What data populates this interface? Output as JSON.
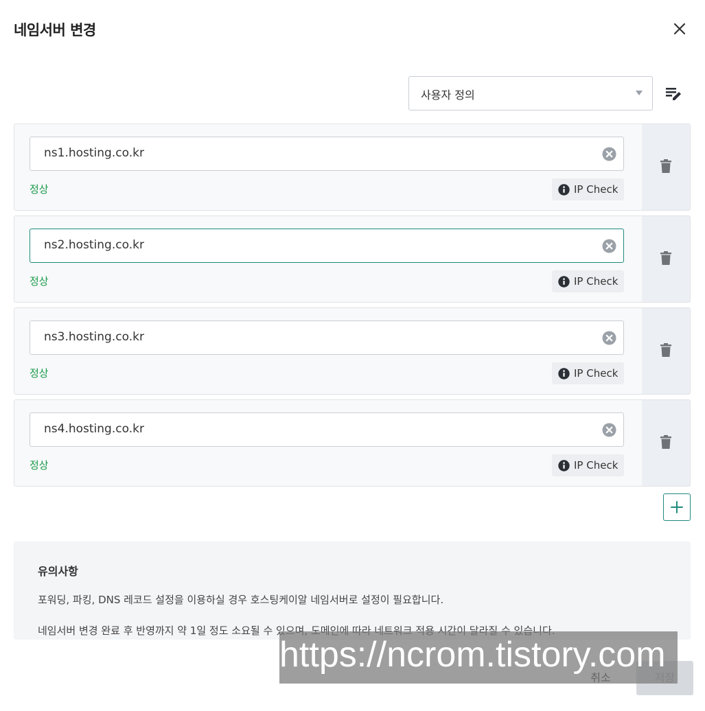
{
  "dialog": {
    "title": "네임서버 변경",
    "close_icon": "close-icon"
  },
  "preset": {
    "selected": "사용자 정의",
    "edit_icon": "edit-note-icon"
  },
  "nameservers": [
    {
      "value": "ns1.hosting.co.kr",
      "status": "정상",
      "check_label": "IP Check",
      "focused": false
    },
    {
      "value": "ns2.hosting.co.kr",
      "status": "정상",
      "check_label": "IP Check",
      "focused": true
    },
    {
      "value": "ns3.hosting.co.kr",
      "status": "정상",
      "check_label": "IP Check",
      "focused": false
    },
    {
      "value": "ns4.hosting.co.kr",
      "status": "정상",
      "check_label": "IP Check",
      "focused": false
    }
  ],
  "add_icon": "plus-icon",
  "notice": {
    "title": "유의사항",
    "lines": [
      "포워딩, 파킹, DNS 레코드 설정을 이용하실 경우 호스팅케이알 네임서버로 설정이 필요합니다.",
      "네임서버 변경 완료 후 반영까지 약 1일 정도 소요될 수 있으며, 도메인에 따라 네트워크 적용 시간이 달라질 수 있습니다."
    ]
  },
  "footer": {
    "cancel_label": "취소",
    "save_label": "저장"
  },
  "watermark": "https://ncrom.tistory.com",
  "colors": {
    "accent": "#1f8a7e",
    "status_ok": "#1a9a4a",
    "save_disabled_bg": "#d6d9dd"
  }
}
